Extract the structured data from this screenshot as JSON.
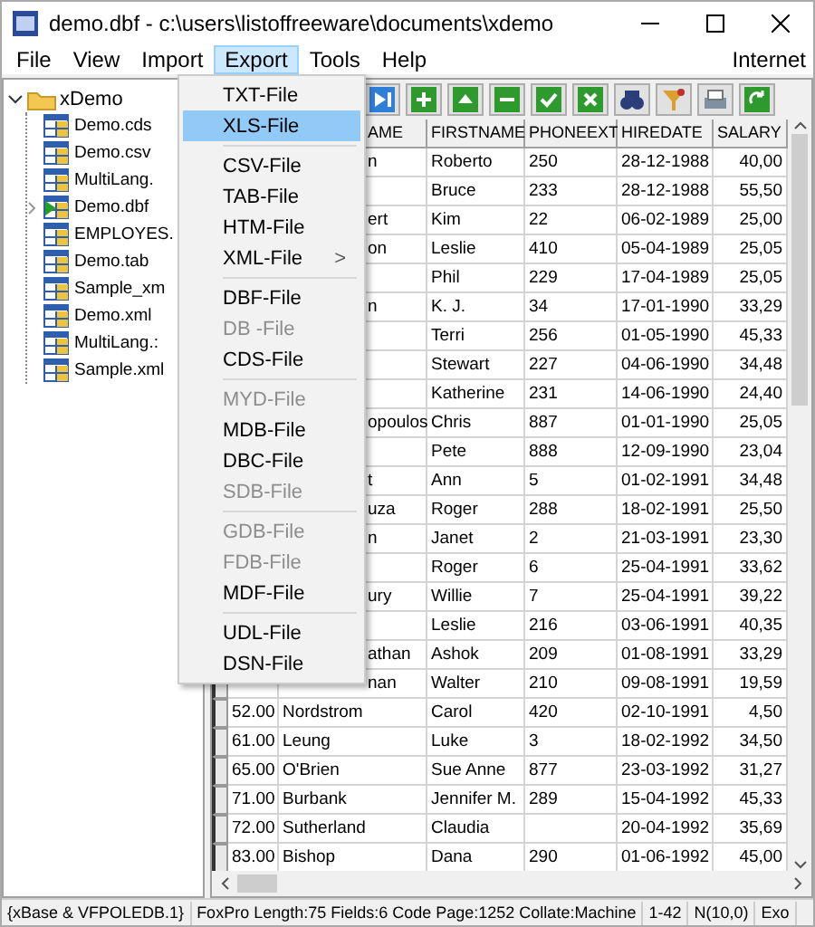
{
  "window": {
    "title": "demo.dbf - c:\\users\\listoffreeware\\documents\\xdemo"
  },
  "menu_bar": {
    "items": [
      {
        "label": "File",
        "selected": false
      },
      {
        "label": "View",
        "selected": false
      },
      {
        "label": "Import",
        "selected": false
      },
      {
        "label": "Export",
        "selected": true
      },
      {
        "label": "Tools",
        "selected": false
      },
      {
        "label": "Help",
        "selected": false
      }
    ],
    "right": "Internet"
  },
  "tree": {
    "label": "xDemo",
    "expanded": true,
    "children": [
      {
        "label": "Demo.cds",
        "collapsed": false,
        "active": false
      },
      {
        "label": "Demo.csv",
        "collapsed": false,
        "active": false
      },
      {
        "label": "MultiLang.",
        "collapsed": false,
        "active": false
      },
      {
        "label": "Demo.dbf",
        "collapsed": true,
        "active": true
      },
      {
        "label": "EMPLOYES.",
        "collapsed": false,
        "active": false
      },
      {
        "label": "Demo.tab",
        "collapsed": false,
        "active": false
      },
      {
        "label": "Sample_xm",
        "collapsed": false,
        "active": false
      },
      {
        "label": "Demo.xml",
        "collapsed": false,
        "active": false
      },
      {
        "label": "MultiLang.:",
        "collapsed": false,
        "active": false
      },
      {
        "label": "Sample.xml",
        "collapsed": false,
        "active": false
      }
    ]
  },
  "grid": {
    "columns": [
      "AME",
      "FIRSTNAME",
      "PHONEEXT",
      "HIREDATE",
      "SALARY"
    ],
    "rows": [
      {
        "last_name": "n",
        "first_name": "Roberto",
        "phone_ext": "250",
        "hire_date": "28-12-1988",
        "salary": "40,00"
      },
      {
        "first_name": "Bruce",
        "phone_ext": "233",
        "hire_date": "28-12-1988",
        "salary": "55,50"
      },
      {
        "last_name": "ert",
        "first_name": "Kim",
        "phone_ext": "22",
        "hire_date": "06-02-1989",
        "salary": "25,00"
      },
      {
        "last_name": "on",
        "first_name": "Leslie",
        "phone_ext": "410",
        "hire_date": "05-04-1989",
        "salary": "25,05"
      },
      {
        "first_name": "Phil",
        "phone_ext": "229",
        "hire_date": "17-04-1989",
        "salary": "25,05"
      },
      {
        "last_name": "n",
        "first_name": "K. J.",
        "phone_ext": "34",
        "hire_date": "17-01-1990",
        "salary": "33,29"
      },
      {
        "first_name": "Terri",
        "phone_ext": "256",
        "hire_date": "01-05-1990",
        "salary": "45,33"
      },
      {
        "first_name": "Stewart",
        "phone_ext": "227",
        "hire_date": "04-06-1990",
        "salary": "34,48"
      },
      {
        "first_name": "Katherine",
        "phone_ext": "231",
        "hire_date": "14-06-1990",
        "salary": "24,40"
      },
      {
        "last_name": "opoulos",
        "first_name": "Chris",
        "phone_ext": "887",
        "hire_date": "01-01-1990",
        "salary": "25,05"
      },
      {
        "first_name": "Pete",
        "phone_ext": "888",
        "hire_date": "12-09-1990",
        "salary": "23,04"
      },
      {
        "last_name": "t",
        "first_name": "Ann",
        "phone_ext": "5",
        "hire_date": "01-02-1991",
        "salary": "34,48"
      },
      {
        "last_name": "uza",
        "first_name": "Roger",
        "phone_ext": "288",
        "hire_date": "18-02-1991",
        "salary": "25,50"
      },
      {
        "last_name": "n",
        "first_name": "Janet",
        "phone_ext": "2",
        "hire_date": "21-03-1991",
        "salary": "23,30"
      },
      {
        "first_name": "Roger",
        "phone_ext": "6",
        "hire_date": "25-04-1991",
        "salary": "33,62"
      },
      {
        "last_name": "ury",
        "first_name": "Willie",
        "phone_ext": "7",
        "hire_date": "25-04-1991",
        "salary": "39,22"
      },
      {
        "first_name": "Leslie",
        "phone_ext": "216",
        "hire_date": "03-06-1991",
        "salary": "40,35"
      },
      {
        "last_name": "athan",
        "first_name": "Ashok",
        "phone_ext": "209",
        "hire_date": "01-08-1991",
        "salary": "33,29"
      },
      {
        "last_name": "nan",
        "first_name": "Walter",
        "phone_ext": "210",
        "hire_date": "09-08-1991",
        "salary": "19,59"
      },
      {
        "number": "52.00",
        "last_name": "Nordstrom",
        "first_name": "Carol",
        "phone_ext": "420",
        "hire_date": "02-10-1991",
        "salary": "4,50"
      },
      {
        "number": "61.00",
        "last_name": "Leung",
        "first_name": "Luke",
        "phone_ext": "3",
        "hire_date": "18-02-1992",
        "salary": "34,50"
      },
      {
        "number": "65.00",
        "last_name": "O'Brien",
        "first_name": "Sue Anne",
        "phone_ext": "877",
        "hire_date": "23-03-1992",
        "salary": "31,27"
      },
      {
        "number": "71.00",
        "last_name": "Burbank",
        "first_name": "Jennifer M.",
        "phone_ext": "289",
        "hire_date": "15-04-1992",
        "salary": "45,33"
      },
      {
        "number": "72.00",
        "last_name": "Sutherland",
        "first_name": "Claudia",
        "hire_date": "20-04-1992",
        "salary": "35,69"
      },
      {
        "number": "83.00",
        "last_name": "Bishop",
        "first_name": "Dana",
        "phone_ext": "290",
        "hire_date": "01-06-1992",
        "salary": "45,00"
      }
    ]
  },
  "export_menu": [
    {
      "kind": "item",
      "label": "TXT-File",
      "selected": false,
      "disabled": false
    },
    {
      "kind": "item",
      "label": "XLS-File",
      "selected": true,
      "disabled": false
    },
    {
      "kind": "separator"
    },
    {
      "kind": "item",
      "label": "CSV-File",
      "selected": false,
      "disabled": false
    },
    {
      "kind": "item",
      "label": "TAB-File",
      "selected": false,
      "disabled": false
    },
    {
      "kind": "item",
      "label": "HTM-File",
      "selected": false,
      "disabled": false
    },
    {
      "kind": "submenu",
      "label": "XML-File",
      "arrow": ">",
      "selected": false,
      "disabled": false
    },
    {
      "kind": "separator"
    },
    {
      "kind": "item",
      "label": "DBF-File",
      "selected": false,
      "disabled": false
    },
    {
      "kind": "item",
      "label": "DB -File",
      "selected": false,
      "disabled": true
    },
    {
      "kind": "item",
      "label": "CDS-File",
      "selected": false,
      "disabled": false
    },
    {
      "kind": "separator"
    },
    {
      "kind": "item",
      "label": "MYD-File",
      "selected": false,
      "disabled": true
    },
    {
      "kind": "item",
      "label": "MDB-File",
      "selected": false,
      "disabled": false
    },
    {
      "kind": "item",
      "label": "DBC-File",
      "selected": false,
      "disabled": false
    },
    {
      "kind": "item",
      "label": "SDB-File",
      "selected": false,
      "disabled": true
    },
    {
      "kind": "separator"
    },
    {
      "kind": "item",
      "label": "GDB-File",
      "selected": false,
      "disabled": true
    },
    {
      "kind": "item",
      "label": "FDB-File",
      "selected": false,
      "disabled": true
    },
    {
      "kind": "item",
      "label": "MDF-File",
      "selected": false,
      "disabled": false
    },
    {
      "kind": "separator"
    },
    {
      "kind": "item",
      "label": "UDL-File",
      "selected": false,
      "disabled": false
    },
    {
      "kind": "item",
      "label": "DSN-File",
      "selected": false,
      "disabled": false
    }
  ],
  "status_bar": [
    "{xBase & VFPOLEDB.1}",
    "FoxPro Length:75 Fields:6 Code Page:1252 Collate:Machine",
    "1-42",
    "N(10,0)",
    "Exo"
  ]
}
